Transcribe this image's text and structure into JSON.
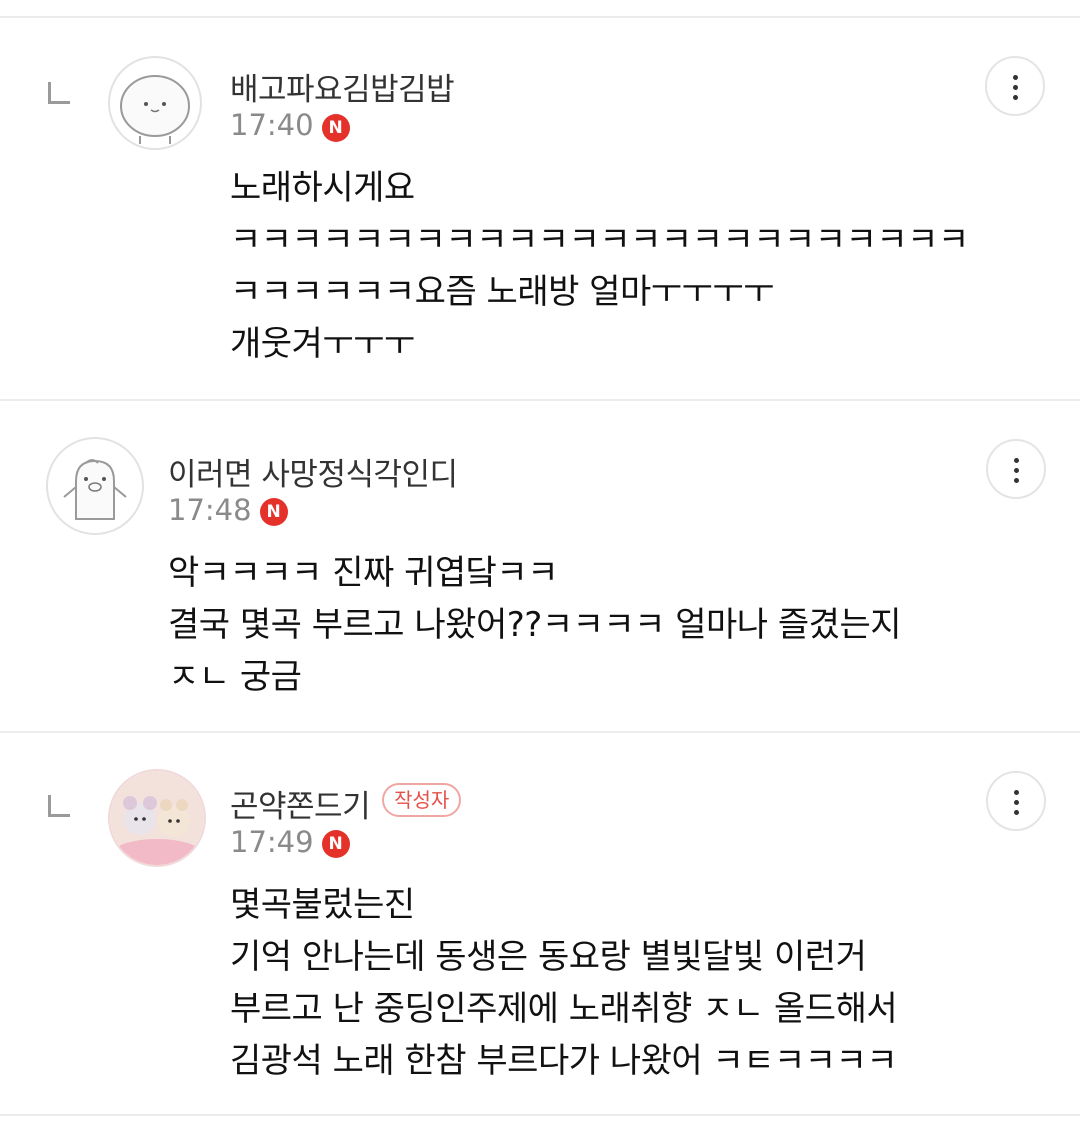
{
  "comments": [
    {
      "author": "배고파요김밥김밥",
      "time": "17:40",
      "new_badge": "N",
      "lines": [
        "노래하시게요",
        "ㅋㅋㅋㅋㅋㅋㅋㅋㅋㅋㅋㅋㅋㅋㅋㅋㅋㅋㅋㅋㅋㅋㅋㅋ",
        "ㅋㅋㅋㅋㅋㅋ요즘 노래방 얼마ㅜㅜㅜㅜ",
        "개웃겨ㅜㅜㅜ"
      ]
    },
    {
      "author": "이러면 사망정식각인디",
      "time": "17:48",
      "new_badge": "N",
      "lines": [
        "악ㅋㅋㅋㅋ 진짜 귀엽닼ㅋㅋ",
        "결국 몇곡 부르고 나왔어??ㅋㅋㅋㅋ 얼마나 즐겼는지",
        "ㅈㄴ 궁금"
      ]
    },
    {
      "author": "곤약쫀드기",
      "writer_badge": "작성자",
      "time": "17:49",
      "new_badge": "N",
      "lines": [
        "몇곡불렀는진",
        "기억 안나는데 동생은 동요랑 별빛달빛 이런거",
        "부르고 난 중딩인주제에 노래취향 ㅈㄴ 올드해서",
        "김광석 노래 한참 부르다가 나왔어 ㅋㅌㅋㅋㅋㅋ"
      ]
    }
  ],
  "icons": {
    "more": "more-vertical-icon",
    "reply": "reply-arrow-icon",
    "new": "new-badge-icon"
  },
  "colors": {
    "new_badge": "#e4322a",
    "writer_badge": "#e4504a",
    "time": "#8a8a8a",
    "divider": "#ececec"
  }
}
